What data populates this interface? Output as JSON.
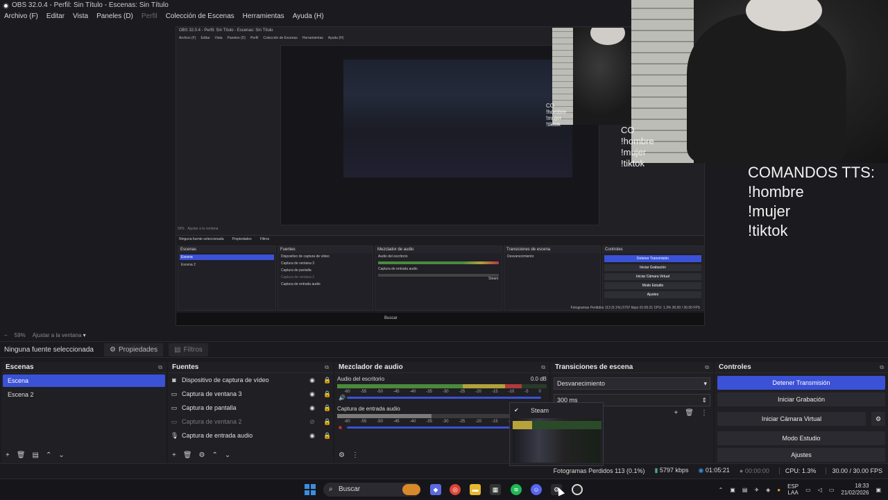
{
  "window": {
    "title": "OBS 32.0.4 - Perfil: Sin Título - Escenas: Sin Título"
  },
  "menu": [
    "Archivo (F)",
    "Editar",
    "Vista",
    "Paneles (D)",
    "Perfil",
    "Colección de Escenas",
    "Herramientas",
    "Ayuda (H)"
  ],
  "overlay": {
    "tts_title": "COMANDOS TTS:",
    "tts_cmds": [
      "!hombre",
      "!mujer",
      "!tiktok"
    ],
    "tts_small_title": "CO",
    "tts_tiny_title": "CO"
  },
  "nested": {
    "title": "OBS 32.0.4 - Perfil: Sin Título - Escenas: Sin Título",
    "menu": [
      "Archivo (F)",
      "Editar",
      "Vista",
      "Paneles (D)",
      "Perfil",
      "Colección de Escenas",
      "Herramientas",
      "Ayuda (H)"
    ],
    "zoom": "59%",
    "fit": "Ajustar a la ventana",
    "no_source": "Ninguna fuente seleccionada",
    "props": "Propiedades",
    "filters": "Filtros",
    "scenes_h": "Escenas",
    "scenes": [
      "Escena",
      "Escena 2"
    ],
    "sources_h": "Fuentes",
    "sources": [
      "Dispositivo de captura de vídeo",
      "Captura de ventana 3",
      "Captura de pantalla",
      "Captura de ventana 2",
      "Captura de entrada audio"
    ],
    "mixer_h": "Mezclador de audio",
    "mixer_1": "Audio del escritorio",
    "mixer_2": "Captura de entrada audio",
    "trans_h": "Transiciones de escena",
    "trans": "Desvanecimiento",
    "ctrl_h": "Controles",
    "controls": [
      "Detener Transmisión",
      "Iniciar Grabación",
      "Iniciar Cámara Virtual",
      "Modo Estudio",
      "Ajustes"
    ],
    "status": "Fotogramas Perdidos 113 (0.1%)   5797 kbps   01:05:21   CPU: 1.3%   30.00 / 30.00 FPS",
    "search": "Buscar",
    "steam": "Steam"
  },
  "preview": {
    "zoom": "59%",
    "fit": "Ajustar a la ventana"
  },
  "source_toolbar": {
    "no_selection": "Ninguna fuente seleccionada",
    "properties": "Propiedades",
    "filters": "Filtros"
  },
  "scenes": {
    "title": "Escenas",
    "items": [
      {
        "label": "Escena",
        "selected": true
      },
      {
        "label": "Escena 2",
        "selected": false
      }
    ]
  },
  "sources": {
    "title": "Fuentes",
    "items": [
      {
        "icon": "camera-icon",
        "label": "Dispositivo de captura de vídeo",
        "visible": true
      },
      {
        "icon": "window-icon",
        "label": "Captura de ventana 3",
        "visible": true
      },
      {
        "icon": "monitor-icon",
        "label": "Captura de pantalla",
        "visible": true
      },
      {
        "icon": "window-icon",
        "label": "Captura de ventana 2",
        "visible": false
      },
      {
        "icon": "mic-icon",
        "label": "Captura de entrada audio",
        "visible": true
      }
    ]
  },
  "mixer": {
    "title": "Mezclador de audio",
    "channels": [
      {
        "name": "Audio del escritorio",
        "db": "0.0 dB"
      },
      {
        "name": "Captura de entrada audio",
        "db": ""
      }
    ],
    "ticks": [
      "-60",
      "-55",
      "-50",
      "-45",
      "-40",
      "-35",
      "-30",
      "-25",
      "-20",
      "-15",
      "-10",
      "-5",
      "0"
    ]
  },
  "transitions": {
    "title": "Transiciones de escena",
    "selected": "Desvanecimiento",
    "duration": "300 ms"
  },
  "steam_popup": {
    "label": "Steam"
  },
  "controls": {
    "title": "Controles",
    "buttons": [
      "Detener Transmisión",
      "Iniciar Grabación",
      "Iniciar Cámara Virtual",
      "Modo Estudio",
      "Ajustes"
    ]
  },
  "status": {
    "dropped": "Fotogramas Perdidos 113 (0.1%)",
    "kbps": "5797 kbps",
    "stream_time": "01:05:21",
    "rec_time": "00:00:00",
    "cpu": "CPU: 1.3%",
    "fps": "30.00 / 30.00 FPS"
  },
  "taskbar": {
    "search": "Buscar",
    "lang_1": "ESP",
    "lang_2": "LAA",
    "time": "18:33",
    "date": "21/02/2026"
  },
  "colors": {
    "accent": "#3b52d6",
    "bg": "#1b1b1f"
  }
}
